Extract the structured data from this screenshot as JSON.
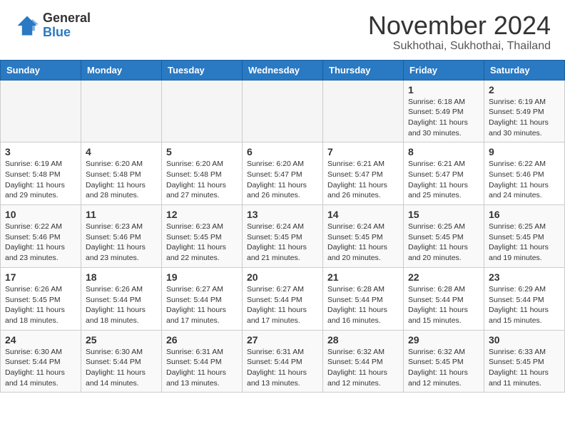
{
  "header": {
    "logo": {
      "general": "General",
      "blue": "Blue"
    },
    "month": "November 2024",
    "location": "Sukhothai, Sukhothai, Thailand"
  },
  "calendar": {
    "days_of_week": [
      "Sunday",
      "Monday",
      "Tuesday",
      "Wednesday",
      "Thursday",
      "Friday",
      "Saturday"
    ],
    "weeks": [
      [
        {
          "day": "",
          "empty": true
        },
        {
          "day": "",
          "empty": true
        },
        {
          "day": "",
          "empty": true
        },
        {
          "day": "",
          "empty": true
        },
        {
          "day": "",
          "empty": true
        },
        {
          "day": "1",
          "sunrise": "6:18 AM",
          "sunset": "5:49 PM",
          "daylight": "11 hours and 30 minutes."
        },
        {
          "day": "2",
          "sunrise": "6:19 AM",
          "sunset": "5:49 PM",
          "daylight": "11 hours and 30 minutes."
        }
      ],
      [
        {
          "day": "3",
          "sunrise": "6:19 AM",
          "sunset": "5:48 PM",
          "daylight": "11 hours and 29 minutes."
        },
        {
          "day": "4",
          "sunrise": "6:20 AM",
          "sunset": "5:48 PM",
          "daylight": "11 hours and 28 minutes."
        },
        {
          "day": "5",
          "sunrise": "6:20 AM",
          "sunset": "5:48 PM",
          "daylight": "11 hours and 27 minutes."
        },
        {
          "day": "6",
          "sunrise": "6:20 AM",
          "sunset": "5:47 PM",
          "daylight": "11 hours and 26 minutes."
        },
        {
          "day": "7",
          "sunrise": "6:21 AM",
          "sunset": "5:47 PM",
          "daylight": "11 hours and 26 minutes."
        },
        {
          "day": "8",
          "sunrise": "6:21 AM",
          "sunset": "5:47 PM",
          "daylight": "11 hours and 25 minutes."
        },
        {
          "day": "9",
          "sunrise": "6:22 AM",
          "sunset": "5:46 PM",
          "daylight": "11 hours and 24 minutes."
        }
      ],
      [
        {
          "day": "10",
          "sunrise": "6:22 AM",
          "sunset": "5:46 PM",
          "daylight": "11 hours and 23 minutes."
        },
        {
          "day": "11",
          "sunrise": "6:23 AM",
          "sunset": "5:46 PM",
          "daylight": "11 hours and 23 minutes."
        },
        {
          "day": "12",
          "sunrise": "6:23 AM",
          "sunset": "5:45 PM",
          "daylight": "11 hours and 22 minutes."
        },
        {
          "day": "13",
          "sunrise": "6:24 AM",
          "sunset": "5:45 PM",
          "daylight": "11 hours and 21 minutes."
        },
        {
          "day": "14",
          "sunrise": "6:24 AM",
          "sunset": "5:45 PM",
          "daylight": "11 hours and 20 minutes."
        },
        {
          "day": "15",
          "sunrise": "6:25 AM",
          "sunset": "5:45 PM",
          "daylight": "11 hours and 20 minutes."
        },
        {
          "day": "16",
          "sunrise": "6:25 AM",
          "sunset": "5:45 PM",
          "daylight": "11 hours and 19 minutes."
        }
      ],
      [
        {
          "day": "17",
          "sunrise": "6:26 AM",
          "sunset": "5:45 PM",
          "daylight": "11 hours and 18 minutes."
        },
        {
          "day": "18",
          "sunrise": "6:26 AM",
          "sunset": "5:44 PM",
          "daylight": "11 hours and 18 minutes."
        },
        {
          "day": "19",
          "sunrise": "6:27 AM",
          "sunset": "5:44 PM",
          "daylight": "11 hours and 17 minutes."
        },
        {
          "day": "20",
          "sunrise": "6:27 AM",
          "sunset": "5:44 PM",
          "daylight": "11 hours and 17 minutes."
        },
        {
          "day": "21",
          "sunrise": "6:28 AM",
          "sunset": "5:44 PM",
          "daylight": "11 hours and 16 minutes."
        },
        {
          "day": "22",
          "sunrise": "6:28 AM",
          "sunset": "5:44 PM",
          "daylight": "11 hours and 15 minutes."
        },
        {
          "day": "23",
          "sunrise": "6:29 AM",
          "sunset": "5:44 PM",
          "daylight": "11 hours and 15 minutes."
        }
      ],
      [
        {
          "day": "24",
          "sunrise": "6:30 AM",
          "sunset": "5:44 PM",
          "daylight": "11 hours and 14 minutes."
        },
        {
          "day": "25",
          "sunrise": "6:30 AM",
          "sunset": "5:44 PM",
          "daylight": "11 hours and 14 minutes."
        },
        {
          "day": "26",
          "sunrise": "6:31 AM",
          "sunset": "5:44 PM",
          "daylight": "11 hours and 13 minutes."
        },
        {
          "day": "27",
          "sunrise": "6:31 AM",
          "sunset": "5:44 PM",
          "daylight": "11 hours and 13 minutes."
        },
        {
          "day": "28",
          "sunrise": "6:32 AM",
          "sunset": "5:44 PM",
          "daylight": "11 hours and 12 minutes."
        },
        {
          "day": "29",
          "sunrise": "6:32 AM",
          "sunset": "5:45 PM",
          "daylight": "11 hours and 12 minutes."
        },
        {
          "day": "30",
          "sunrise": "6:33 AM",
          "sunset": "5:45 PM",
          "daylight": "11 hours and 11 minutes."
        }
      ]
    ]
  }
}
